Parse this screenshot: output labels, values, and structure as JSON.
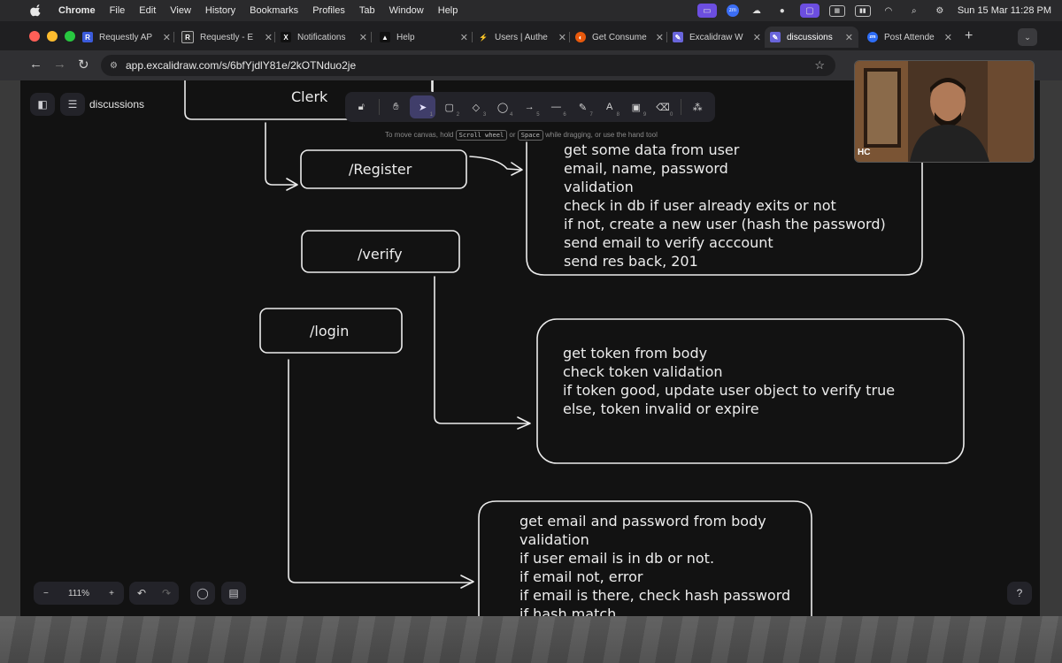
{
  "menubar": {
    "app": "Chrome",
    "items": [
      "File",
      "Edit",
      "View",
      "History",
      "Bookmarks",
      "Profiles",
      "Tab",
      "Window",
      "Help"
    ],
    "clock": "Sun 15 Mar  11:28 PM"
  },
  "tabs": [
    {
      "title": "Requestly AP",
      "fav_color": "#3b5bdb",
      "fav": "R"
    },
    {
      "title": "Requestly - E",
      "fav_color": "#2b2b2b",
      "fav": "R"
    },
    {
      "title": "Notifications",
      "fav_color": "#111111",
      "fav": "X"
    },
    {
      "title": "Help",
      "fav_color": "#111111",
      "fav": "▲"
    },
    {
      "title": "Users | Authe",
      "fav_color": "#1f1f21",
      "fav": "⚡"
    },
    {
      "title": "Get Consume",
      "fav_color": "#e8590c",
      "fav": "◐"
    },
    {
      "title": "Excalidraw W",
      "fav_color": "#6965db",
      "fav": "✎"
    },
    {
      "title": "discussions",
      "fav_color": "#6965db",
      "fav": "✎"
    },
    {
      "title": "Post Attende",
      "fav_color": "#2d6df6",
      "fav": "zm"
    }
  ],
  "address": {
    "url": "app.excalidraw.com/s/6bfYjdlY81e/2kOTNduo2je"
  },
  "excalidraw": {
    "doc_name": "discussions",
    "zoom": "111%",
    "hint": {
      "pre": "To move canvas, hold",
      "key1": "Scroll wheel",
      "mid": "or",
      "key2": "Space",
      "post": "while dragging, or use the hand tool"
    },
    "tools": [
      {
        "name": "lock-icon",
        "glyph": "🔓︎",
        "key": ""
      },
      {
        "name": "hand-icon",
        "glyph": "✋︎",
        "key": ""
      },
      {
        "name": "selection-icon",
        "glyph": "➤",
        "key": "1",
        "selected": true
      },
      {
        "name": "rectangle-icon",
        "glyph": "▢",
        "key": "2"
      },
      {
        "name": "diamond-icon",
        "glyph": "◇",
        "key": "3"
      },
      {
        "name": "ellipse-icon",
        "glyph": "◯",
        "key": "4"
      },
      {
        "name": "arrow-icon",
        "glyph": "→",
        "key": "5"
      },
      {
        "name": "line-icon",
        "glyph": "—",
        "key": "6"
      },
      {
        "name": "draw-icon",
        "glyph": "✎",
        "key": "7"
      },
      {
        "name": "text-icon",
        "glyph": "A",
        "key": "8"
      },
      {
        "name": "image-icon",
        "glyph": "▣",
        "key": "9"
      },
      {
        "name": "eraser-icon",
        "glyph": "⌫",
        "key": "0"
      },
      {
        "name": "more-tools-icon",
        "glyph": "⁂",
        "key": ""
      }
    ]
  },
  "diagram": {
    "boxes": {
      "clerk": "Clerk",
      "register": "/Register",
      "verify": "/verify",
      "login": "/login"
    },
    "register_notes": [
      "get some data from user",
      "email, name, password",
      "validation",
      "check in db if user already exits or not",
      "if not, create a new user (hash the password)",
      "send email to verify acccount",
      "send res back, 201"
    ],
    "verify_notes": [
      "get token from body",
      "check token validation",
      "if token good, update user object to verify true",
      "else, token invalid or expire"
    ],
    "login_notes": [
      "get email and password from body",
      "validation",
      "if user email is in db or not.",
      "if email not, error",
      "if email is there, check hash password",
      "if hash match"
    ]
  },
  "webcam": {
    "label": "HC"
  },
  "colors": {
    "canvas": "#121212",
    "stroke": "#ececec",
    "accent": "#6965db"
  }
}
